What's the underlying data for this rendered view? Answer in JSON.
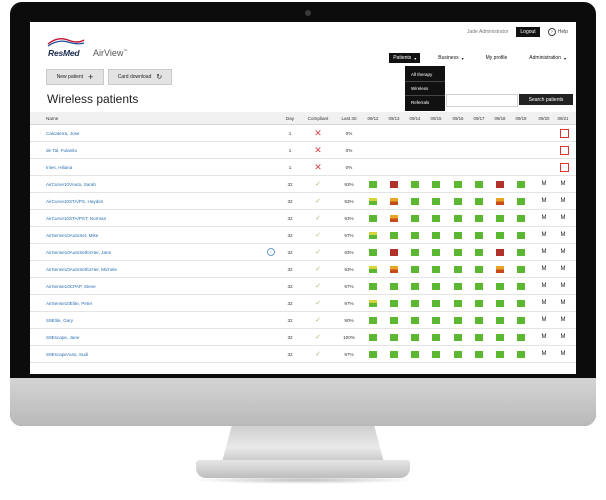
{
  "topbar": {
    "user": "Jade Administrator",
    "logout": "Logout",
    "help": "Help"
  },
  "logo": {
    "brand": "ResMed",
    "product": "AirView",
    "trademark": "™"
  },
  "nav": {
    "items": [
      {
        "label": "Patients",
        "active": true,
        "has_caret": true
      },
      {
        "label": "Business",
        "active": false,
        "has_caret": true
      },
      {
        "label": "My profile",
        "active": false,
        "has_caret": false
      },
      {
        "label": "Administration",
        "active": false,
        "has_caret": true
      }
    ],
    "dropdown": [
      "All therapy",
      "Wireless",
      "Referrals"
    ]
  },
  "toolbar": {
    "new_patient": "New patient",
    "card_download": "Card download"
  },
  "page": {
    "title": "Wireless patients",
    "search_button": "Search patients"
  },
  "table": {
    "headers": {
      "name": "Name",
      "day": "Day",
      "compliant": "Compliant",
      "last30": "Last 30"
    },
    "dates": [
      "09/12",
      "09/13",
      "09/14",
      "09/15",
      "09/16",
      "09/17",
      "09/18",
      "09/19",
      "09/20",
      "09/21"
    ],
    "colors": {
      "green": "#5cb832",
      "red": "#b0322b",
      "split_top": "#e8a426",
      "split_bottom": "#c64a1a",
      "yg_top": "#d7d43a",
      "yg_bottom": "#5cb832"
    },
    "rows": [
      {
        "name": "Calcaterra, Jose",
        "day": "1",
        "compliant": "x",
        "last30": "0%",
        "cells": [
          "",
          "",
          "",
          "",
          "",
          "",
          "",
          "",
          "",
          "box"
        ]
      },
      {
        "name": "de Tal, Fulanito",
        "day": "1",
        "compliant": "x",
        "last30": "0%",
        "cells": [
          "",
          "",
          "",
          "",
          "",
          "",
          "",
          "",
          "",
          "box"
        ]
      },
      {
        "name": "Inies, Hiliana",
        "day": "1",
        "compliant": "x",
        "last30": "0%",
        "cells": [
          "",
          "",
          "",
          "",
          "",
          "",
          "",
          "",
          "",
          "box"
        ]
      },
      {
        "name": "AirCurve10VAuto, Sarah",
        "day": "32",
        "compliant": "v",
        "last30": "93%",
        "cells": [
          "g",
          "r",
          "g",
          "g",
          "g",
          "g",
          "r",
          "g",
          "M",
          "M"
        ]
      },
      {
        "name": "AirCurve10STA/PS, Hayden",
        "day": "32",
        "compliant": "v",
        "last30": "93%",
        "cells": [
          "yg",
          "s",
          "g",
          "g",
          "g",
          "g",
          "s",
          "g",
          "M",
          "M"
        ]
      },
      {
        "name": "AirCurve10STA/PST, Norman",
        "day": "32",
        "compliant": "v",
        "last30": "93%",
        "cells": [
          "g",
          "s",
          "g",
          "g",
          "g",
          "g",
          "g",
          "g",
          "M",
          "M"
        ]
      },
      {
        "name": "AirSense10AutoSet, Mike",
        "day": "32",
        "compliant": "v",
        "last30": "97%",
        "cells": [
          "yg",
          "g",
          "g",
          "g",
          "g",
          "g",
          "g",
          "g",
          "M",
          "M"
        ]
      },
      {
        "name": "AirSense10AutoSetforHer, Jane",
        "day": "32",
        "compliant": "v",
        "last30": "93%",
        "info": true,
        "cells": [
          "g",
          "r",
          "g",
          "g",
          "g",
          "g",
          "r",
          "g",
          "M",
          "M"
        ]
      },
      {
        "name": "AirSense10AutoSetforHer, Michele",
        "day": "32",
        "compliant": "v",
        "last30": "93%",
        "cells": [
          "yg",
          "s",
          "g",
          "g",
          "g",
          "g",
          "s",
          "g",
          "M",
          "M"
        ]
      },
      {
        "name": "AirSense10CPAP, Steve",
        "day": "32",
        "compliant": "v",
        "last30": "97%",
        "cells": [
          "g",
          "g",
          "g",
          "g",
          "g",
          "g",
          "g",
          "g",
          "M",
          "M"
        ]
      },
      {
        "name": "AirSense10Elite, Peter",
        "day": "32",
        "compliant": "v",
        "last30": "97%",
        "cells": [
          "yg",
          "g",
          "g",
          "g",
          "g",
          "g",
          "g",
          "g",
          "M",
          "M"
        ]
      },
      {
        "name": "S9Elite, Gary",
        "day": "32",
        "compliant": "v",
        "last30": "90%",
        "cells": [
          "g",
          "g",
          "g",
          "g",
          "g",
          "g",
          "g",
          "g",
          "M",
          "M"
        ]
      },
      {
        "name": "S9Escape, Jane",
        "day": "32",
        "compliant": "v",
        "last30": "100%",
        "cells": [
          "g",
          "g",
          "g",
          "g",
          "g",
          "g",
          "g",
          "g",
          "M",
          "M"
        ]
      },
      {
        "name": "S9EscapeAuto, Sudi",
        "day": "32",
        "compliant": "v",
        "last30": "97%",
        "cells": [
          "g",
          "g",
          "g",
          "g",
          "g",
          "g",
          "g",
          "g",
          "M",
          "M"
        ]
      }
    ]
  }
}
